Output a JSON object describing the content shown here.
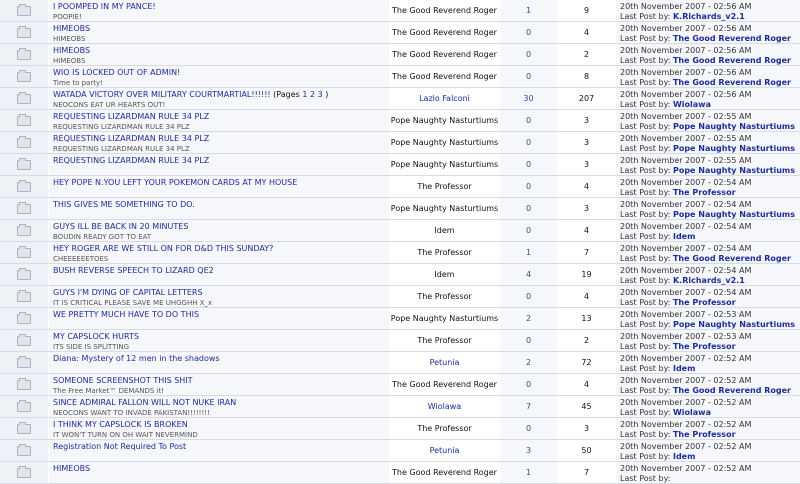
{
  "topics": [
    {
      "title": "I POOMPED IN MY PANCE!",
      "desc": "POOPIE!",
      "author": "The Good Reverend Roger",
      "author_link": false,
      "replies": "1",
      "views": "9",
      "last_date": "20th November 2007 - 02:56 AM",
      "last_by_label": "Last Post by:",
      "last_by": "K.Richards_v2.1"
    },
    {
      "title": "HIMEOBS",
      "desc": "HIMEOBS",
      "author": "The Good Reverend Roger",
      "author_link": false,
      "replies": "0",
      "views": "4",
      "last_date": "20th November 2007 - 02:56 AM",
      "last_by_label": "Last Post by:",
      "last_by": "The Good Reverend Roger"
    },
    {
      "title": "HIMEOBS",
      "desc": "HIMEOBS",
      "author": "The Good Reverend Roger",
      "author_link": false,
      "replies": "0",
      "views": "2",
      "last_date": "20th November 2007 - 02:56 AM",
      "last_by_label": "Last Post by:",
      "last_by": "The Good Reverend Roger"
    },
    {
      "title": "WIO IS LOCKED OUT OF ADMIN!",
      "desc": "Time to party!",
      "author": "The Good Reverend Roger",
      "author_link": false,
      "replies": "0",
      "views": "8",
      "last_date": "20th November 2007 - 02:56 AM",
      "last_by_label": "Last Post by:",
      "last_by": "The Good Reverend Roger"
    },
    {
      "title": "WATADA VICTORY OVER MILITARY COURTMARTIAL!!!!!!",
      "pages_prefix": "(Pages",
      "pages": [
        "1",
        "2",
        "3"
      ],
      "pages_suffix": ")",
      "desc": "NEOCONS EAT UR HEARTS OUT!",
      "author": "Lazlo Falconi",
      "author_link": true,
      "replies": "30",
      "views": "207",
      "last_date": "20th November 2007 - 02:56 AM",
      "last_by_label": "Last Post by:",
      "last_by": "Wiolawa"
    },
    {
      "title": "REQUESTING LIZARDMAN RULE 34 PLZ",
      "desc": "REQUESTING LIZARDMAN RULE 34 PLZ",
      "author": "Pope Naughty Nasturtiums",
      "author_link": false,
      "replies": "0",
      "views": "3",
      "last_date": "20th November 2007 - 02:55 AM",
      "last_by_label": "Last Post by:",
      "last_by": "Pope Naughty Nasturtiums"
    },
    {
      "title": "REQUESTING LIZARDMAN RULE 34 PLZ",
      "desc": "REQUESTING LIZARDMAN RULE 34 PLZ",
      "author": "Pope Naughty Nasturtiums",
      "author_link": false,
      "replies": "0",
      "views": "3",
      "last_date": "20th November 2007 - 02:55 AM",
      "last_by_label": "Last Post by:",
      "last_by": "Pope Naughty Nasturtiums"
    },
    {
      "title": "REQUESTING LIZARDMAN RULE 34 PLZ",
      "desc": "",
      "author": "Pope Naughty Nasturtiums",
      "author_link": false,
      "replies": "0",
      "views": "3",
      "last_date": "20th November 2007 - 02:55 AM",
      "last_by_label": "Last Post by:",
      "last_by": "Pope Naughty Nasturtiums"
    },
    {
      "title": "HEY POPE N.YOU LEFT YOUR POKEMON CARDS AT MY HOUSE",
      "desc": "",
      "author": "The Professor",
      "author_link": false,
      "replies": "0",
      "views": "4",
      "last_date": "20th November 2007 - 02:54 AM",
      "last_by_label": "Last Post by:",
      "last_by": "The Professor"
    },
    {
      "title": "THIS GIVES ME SOMETHING TO DO.",
      "desc": "",
      "author": "Pope Naughty Nasturtiums",
      "author_link": false,
      "replies": "0",
      "views": "3",
      "last_date": "20th November 2007 - 02:54 AM",
      "last_by_label": "Last Post by:",
      "last_by": "Pope Naughty Nasturtiums"
    },
    {
      "title": "GUYS ILL BE BACK IN 20 MINUTES",
      "desc": "BOUDIN READY GOT TO EAT",
      "author": "Idem",
      "author_link": false,
      "replies": "0",
      "views": "4",
      "last_date": "20th November 2007 - 02:54 AM",
      "last_by_label": "Last Post by:",
      "last_by": "Idem"
    },
    {
      "title": "HEY ROGER ARE WE STILL ON FOR D&D THIS SUNDAY?",
      "desc": "CHEEEEEETOES",
      "author": "The Professor",
      "author_link": false,
      "replies": "1",
      "views": "7",
      "last_date": "20th November 2007 - 02:54 AM",
      "last_by_label": "Last Post by:",
      "last_by": "The Good Reverend Roger"
    },
    {
      "title": "BUSH REVERSE SPEECH TO LIZARD QE2",
      "desc": "",
      "author": "Idem",
      "author_link": false,
      "replies": "4",
      "views": "19",
      "last_date": "20th November 2007 - 02:54 AM",
      "last_by_label": "Last Post by:",
      "last_by": "K.Richards_v2.1"
    },
    {
      "title": "GUYS I'M DYING OF CAPITAL LETTERS",
      "desc": "IT IS CRITICAL PLEASE SAVE ME UHGGHH X_x",
      "author": "The Professor",
      "author_link": false,
      "replies": "0",
      "views": "4",
      "last_date": "20th November 2007 - 02:54 AM",
      "last_by_label": "Last Post by:",
      "last_by": "The Professor"
    },
    {
      "title": "WE PRETTY MUCH HAVE TO DO THIS",
      "desc": "",
      "author": "Pope Naughty Nasturtiums",
      "author_link": false,
      "replies": "2",
      "views": "13",
      "last_date": "20th November 2007 - 02:53 AM",
      "last_by_label": "Last Post by:",
      "last_by": "Pope Naughty Nasturtiums"
    },
    {
      "title": "MY CAPSLOCK HURTS",
      "desc": "ITS SIDE IS SPLITTING",
      "author": "The Professor",
      "author_link": false,
      "replies": "0",
      "views": "2",
      "last_date": "20th November 2007 - 02:53 AM",
      "last_by_label": "Last Post by:",
      "last_by": "The Professor"
    },
    {
      "title": "Diana: Mystery of 12 men in the shadows",
      "desc": "",
      "author": "Petunia",
      "author_link": true,
      "replies": "2",
      "views": "72",
      "last_date": "20th November 2007 - 02:52 AM",
      "last_by_label": "Last Post by:",
      "last_by": "Idem"
    },
    {
      "title": "SOMEONE SCREENSHOT THIS SHIT",
      "desc": "The Free Market™ DEMANDS it!",
      "author": "The Good Reverend Roger",
      "author_link": false,
      "replies": "0",
      "views": "4",
      "last_date": "20th November 2007 - 02:52 AM",
      "last_by_label": "Last Post by:",
      "last_by": "The Good Reverend Roger"
    },
    {
      "title": "SINCE ADMIRAL FALLON WILL NOT NUKE IRAN",
      "desc": "NEOCONS WANT TO INVADE PAKISTAN!!!!!!!!",
      "author": "Wiolawa",
      "author_link": true,
      "replies": "7",
      "views": "45",
      "last_date": "20th November 2007 - 02:52 AM",
      "last_by_label": "Last Post by:",
      "last_by": "Wiolawa"
    },
    {
      "title": "I THINK MY CAPSLOCK IS BROKEN",
      "desc": "IT WON'T TURN ON OH WAIT NEVERMIND",
      "author": "The Professor",
      "author_link": false,
      "replies": "0",
      "views": "3",
      "last_date": "20th November 2007 - 02:52 AM",
      "last_by_label": "Last Post by:",
      "last_by": "The Professor"
    },
    {
      "title": "Registration Not Required To Post",
      "desc": "",
      "author": "Petunia",
      "author_link": true,
      "replies": "3",
      "views": "50",
      "last_date": "20th November 2007 - 02:52 AM",
      "last_by_label": "Last Post by:",
      "last_by": "Idem"
    },
    {
      "title": "HIMEOBS",
      "desc": "",
      "author": "The Good Reverend Roger",
      "author_link": false,
      "replies": "1",
      "views": "7",
      "last_date": "20th November 2007 - 02:52 AM",
      "last_by_label": "Last Post by:",
      "last_by": ""
    }
  ]
}
